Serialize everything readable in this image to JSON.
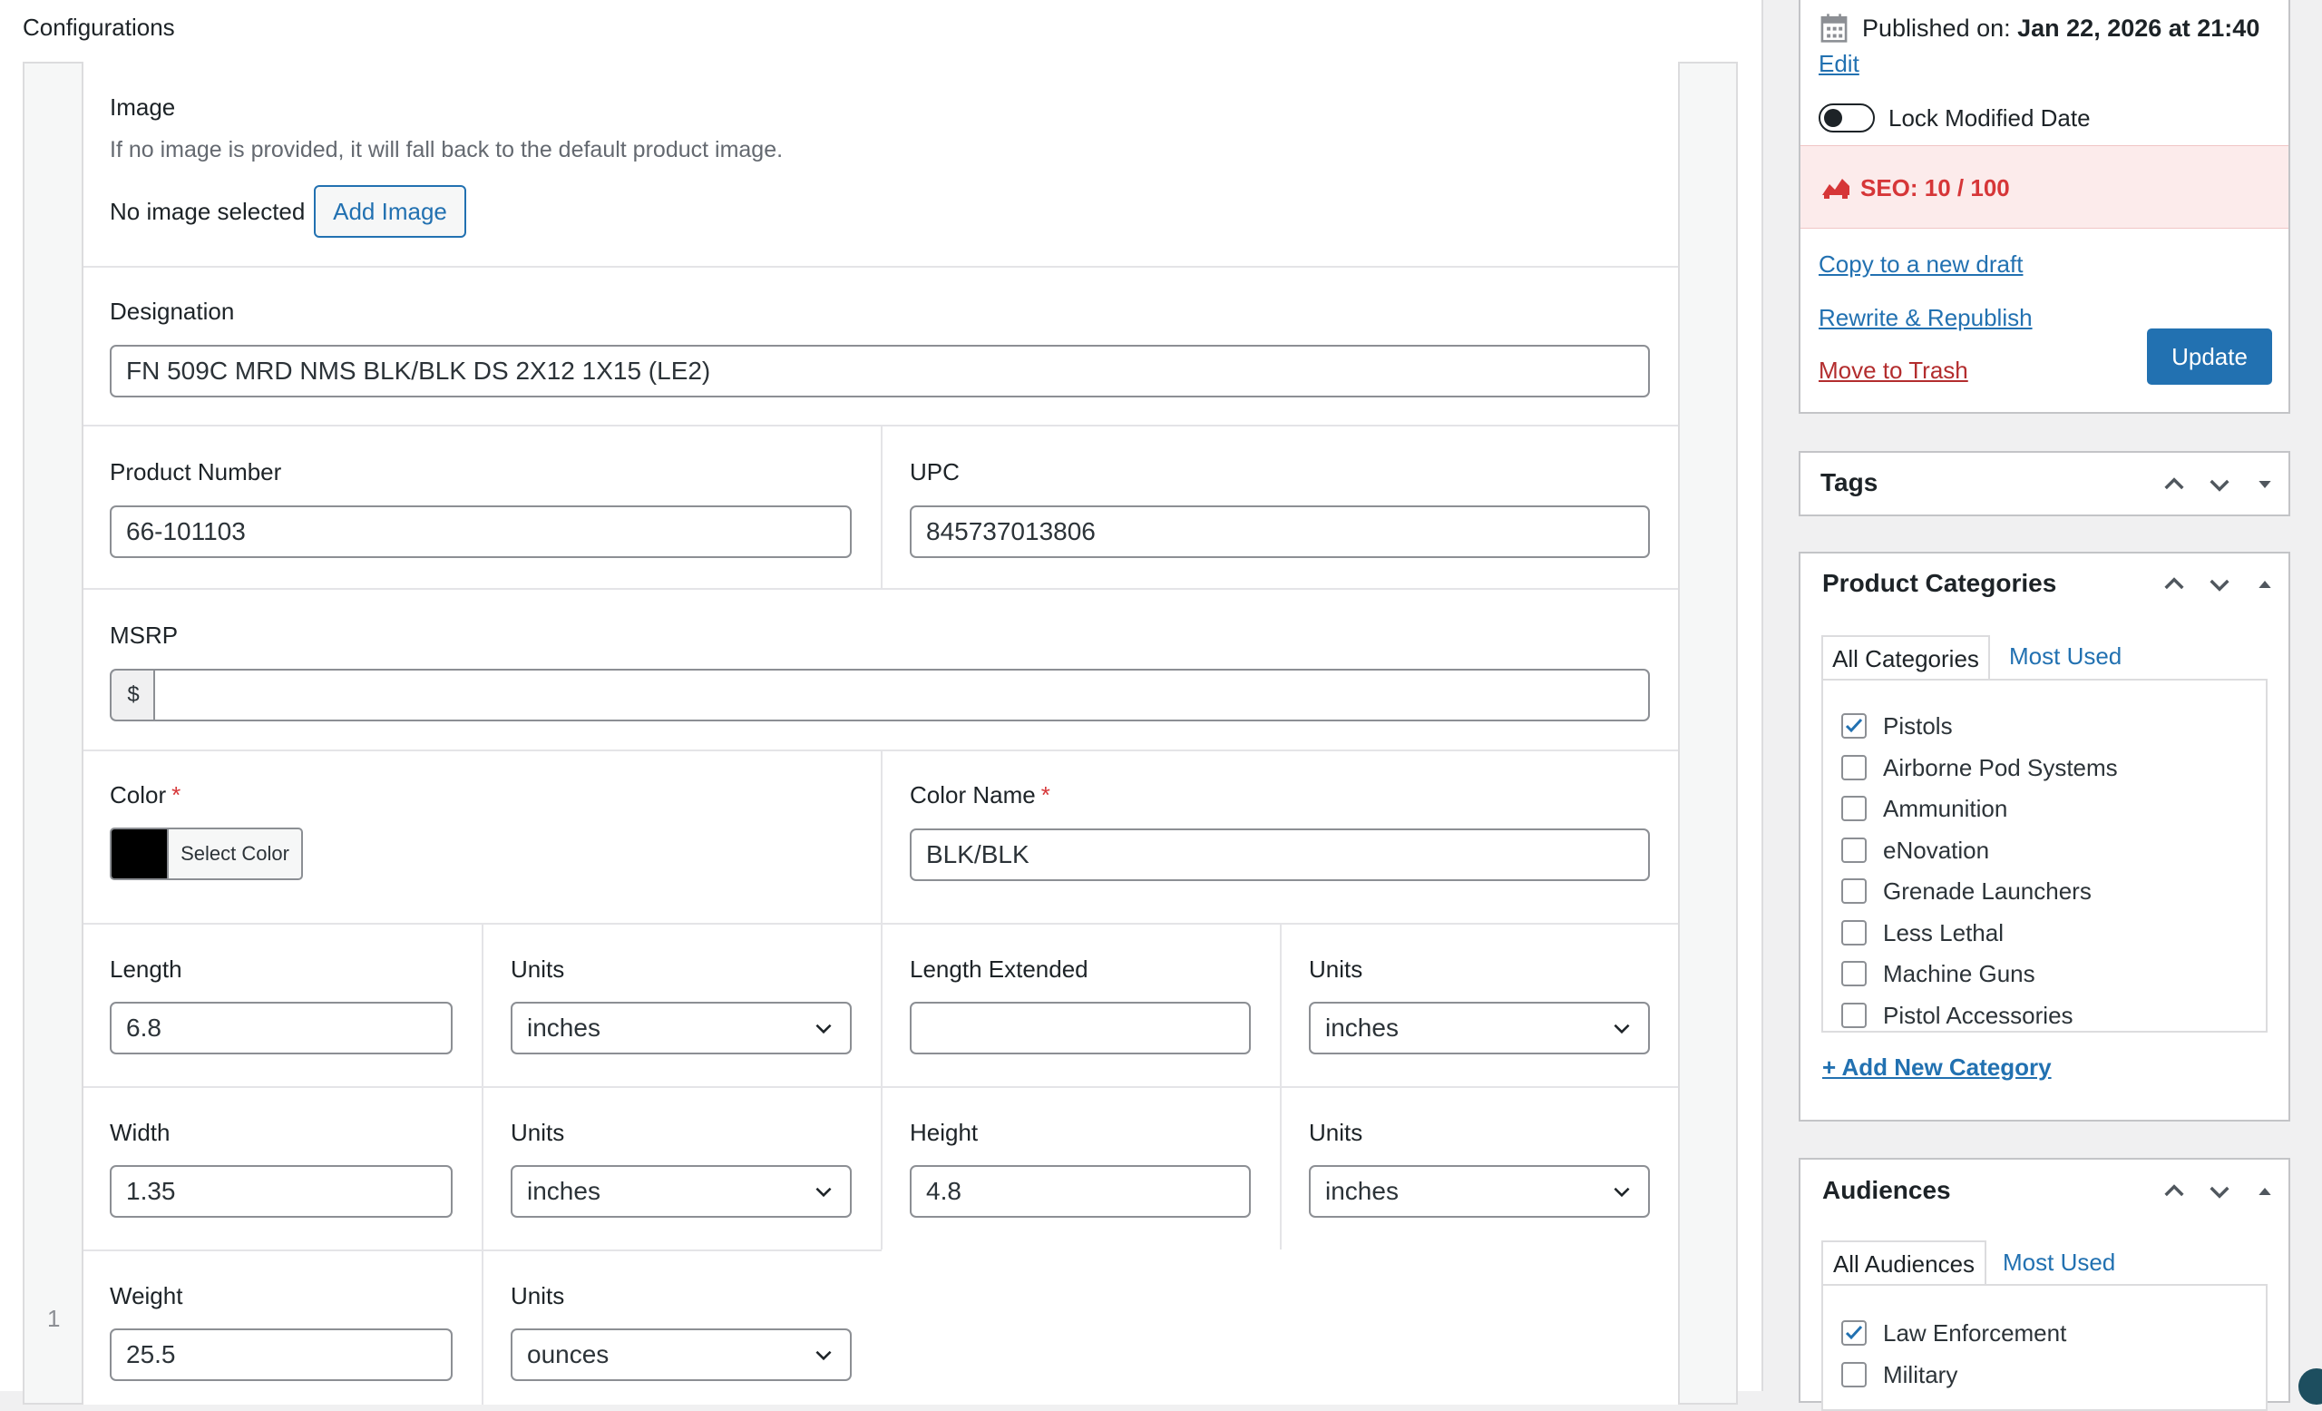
{
  "main": {
    "section_title": "Configurations",
    "row_index": "1",
    "image": {
      "label": "Image",
      "help": "If no image is provided, it will fall back to the default product image.",
      "status": "No image selected",
      "add_button": "Add Image"
    },
    "designation": {
      "label": "Designation",
      "value": "FN 509C MRD NMS BLK/BLK DS 2X12 1X15 (LE2)"
    },
    "product_number": {
      "label": "Product Number",
      "value": "66-101103"
    },
    "upc": {
      "label": "UPC",
      "value": "845737013806"
    },
    "msrp": {
      "label": "MSRP",
      "prefix": "$",
      "value": ""
    },
    "color": {
      "label": "Color",
      "required": "*",
      "button": "Select Color",
      "swatch_hex": "#000000"
    },
    "color_name": {
      "label": "Color Name",
      "required": "*",
      "value": "BLK/BLK"
    },
    "length": {
      "label": "Length",
      "value": "6.8"
    },
    "length_units": {
      "label": "Units",
      "value": "inches"
    },
    "length_extended": {
      "label": "Length Extended",
      "value": ""
    },
    "length_extended_units": {
      "label": "Units",
      "value": "inches"
    },
    "width": {
      "label": "Width",
      "value": "1.35"
    },
    "width_units": {
      "label": "Units",
      "value": "inches"
    },
    "height": {
      "label": "Height",
      "value": "4.8"
    },
    "height_units": {
      "label": "Units",
      "value": "inches"
    },
    "weight": {
      "label": "Weight",
      "value": "25.5"
    },
    "weight_units": {
      "label": "Units",
      "value": "ounces"
    }
  },
  "sidebar": {
    "publish": {
      "published_label": "Published on:",
      "published_date": "Jan 22, 2026 at 21:40",
      "edit_link": "Edit",
      "lock_label": "Lock Modified Date",
      "seo_text": "SEO: 10 / 100",
      "copy_link": "Copy to a new draft",
      "rewrite_link": "Rewrite & Republish",
      "trash_link": "Move to Trash",
      "update_button": "Update"
    },
    "tags": {
      "title": "Tags"
    },
    "categories": {
      "title": "Product Categories",
      "tab_all": "All Categories",
      "tab_most": "Most Used",
      "items": [
        {
          "label": "Pistols",
          "checked": true
        },
        {
          "label": "Airborne Pod Systems",
          "checked": false
        },
        {
          "label": "Ammunition",
          "checked": false
        },
        {
          "label": "eNovation",
          "checked": false
        },
        {
          "label": "Grenade Launchers",
          "checked": false
        },
        {
          "label": "Less Lethal",
          "checked": false
        },
        {
          "label": "Machine Guns",
          "checked": false
        },
        {
          "label": "Pistol Accessories",
          "checked": false
        }
      ],
      "add_link": "+ Add New Category"
    },
    "audiences": {
      "title": "Audiences",
      "tab_all": "All Audiences",
      "tab_most": "Most Used",
      "items": [
        {
          "label": "Law Enforcement",
          "checked": true
        },
        {
          "label": "Military",
          "checked": false
        }
      ]
    }
  },
  "colors": {
    "accent": "#2271b1",
    "danger": "#b32d2e",
    "seo_bg": "#fcebeb",
    "seo_text": "#d63638"
  }
}
